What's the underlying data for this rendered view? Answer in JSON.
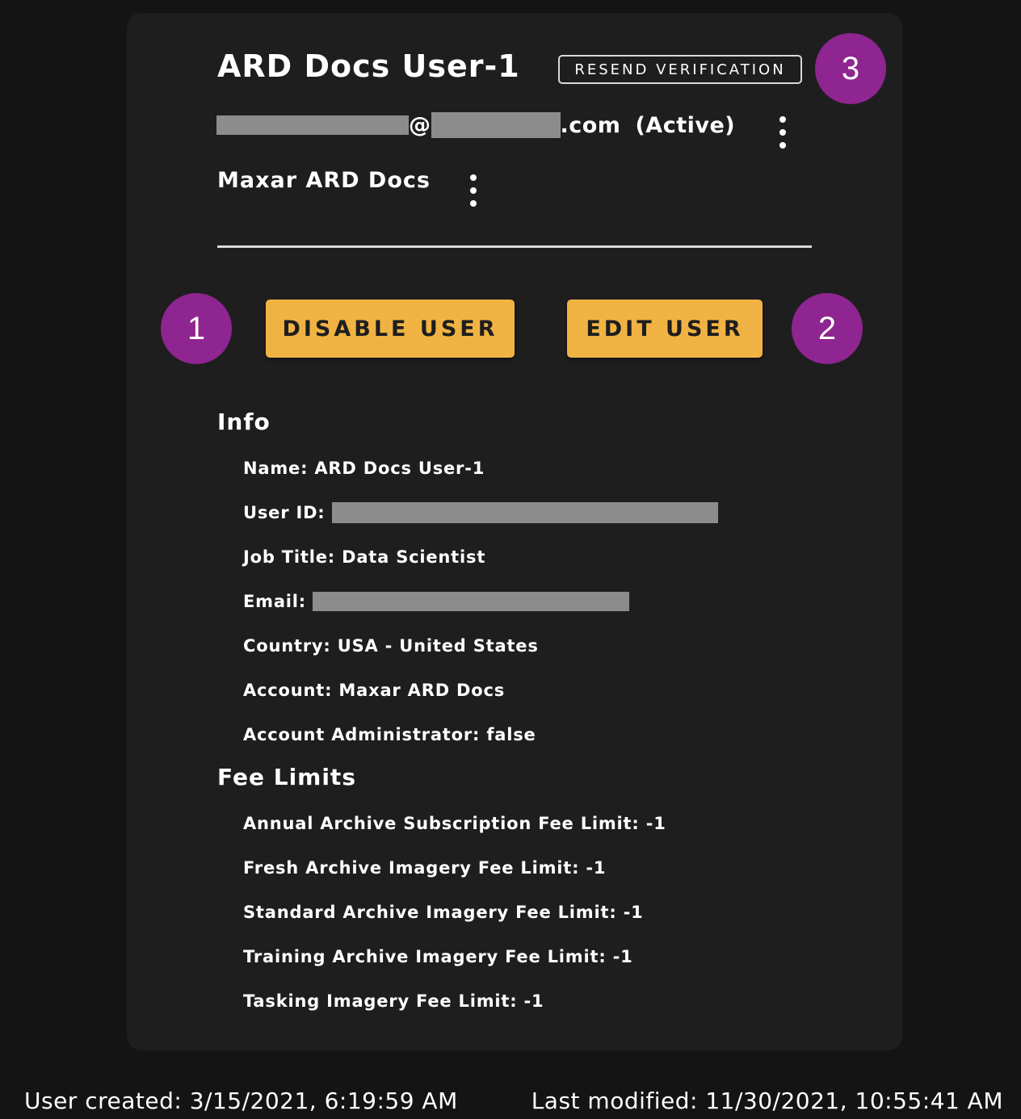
{
  "user": {
    "title": "ARD Docs User-1",
    "resend_label": "RESEND VERIFICATION",
    "email_at": "@",
    "email_suffix": ".com",
    "status": "(Active)",
    "account_name": "Maxar ARD Docs"
  },
  "badges": {
    "one": "1",
    "two": "2",
    "three": "3"
  },
  "actions": {
    "disable_label": "DISABLE USER",
    "edit_label": "EDIT USER"
  },
  "info": {
    "title": "Info",
    "name": "Name: ARD Docs User-1",
    "user_id_label": "User ID:",
    "job_title": "Job Title: Data Scientist",
    "email_label": "Email:",
    "country": "Country: USA - United States",
    "account": "Account: Maxar ARD Docs",
    "admin": "Account Administrator: false"
  },
  "fees": {
    "title": "Fee Limits",
    "items": [
      "Annual Archive Subscription Fee Limit: -1",
      "Fresh Archive Imagery Fee Limit: -1",
      "Standard Archive Imagery Fee Limit: -1",
      "Training Archive Imagery Fee Limit: -1",
      "Tasking Imagery Fee Limit: -1"
    ]
  },
  "footer": {
    "created": "User created: 3/15/2021, 6:19:59 AM",
    "modified": "Last modified: 11/30/2021, 10:55:41 AM"
  },
  "colors": {
    "page_bg": "#141414",
    "card_bg": "#1e1e1f",
    "accent_button": "#f0b343",
    "badge": "#8e2590",
    "redaction": "#8c8c8c"
  }
}
